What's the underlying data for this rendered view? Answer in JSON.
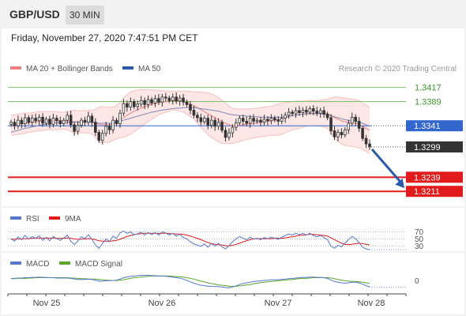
{
  "header": {
    "symbol": "GBP/USD",
    "timeframe": "30 MIN"
  },
  "datetime": "Friday, November 27, 2020 7:47:51 PM CET",
  "credit": "Research © 2020 Trading Central",
  "colors": {
    "bollinger": "#f08080",
    "ma50": "#2a5aa8",
    "candle": "#333333",
    "green_level": "#7cc26a",
    "pivot": "#3366cc",
    "red_level": "#e11b1b",
    "current": "#333333",
    "rsi": "#5577cc",
    "rsi_ma": "#e11b1b",
    "macd": "#5577cc",
    "macd_signal": "#5aa82a",
    "arrow": "#2a5aa8"
  },
  "chart_data": [
    {
      "type": "candlestick",
      "legend": [
        {
          "label": "MA 20 + Bollinger Bands",
          "color": "#f08080"
        },
        {
          "label": "MA 50",
          "color": "#2a5aa8"
        }
      ],
      "ylim": [
        1.318,
        1.344
      ],
      "x_ticks": [
        "Nov 25",
        "Nov 26",
        "Nov 27",
        "Nov 28"
      ],
      "levels": [
        {
          "value": 1.3417,
          "label": "1.3417",
          "style": "green"
        },
        {
          "value": 1.3389,
          "label": "1.3389",
          "style": "green"
        },
        {
          "value": 1.3341,
          "label": "1.3341",
          "style": "pivot"
        },
        {
          "value": 1.3299,
          "label": "1.3299",
          "style": "current"
        },
        {
          "value": 1.3239,
          "label": "1.3239",
          "style": "red"
        },
        {
          "value": 1.3211,
          "label": "1.3211",
          "style": "red"
        }
      ],
      "close": [
        1.3348,
        1.3341,
        1.3352,
        1.3345,
        1.3357,
        1.3348,
        1.3356,
        1.3351,
        1.3358,
        1.3346,
        1.3354,
        1.3344,
        1.3356,
        1.3351,
        1.3345,
        1.3352,
        1.3362,
        1.3343,
        1.333,
        1.3342,
        1.3352,
        1.3348,
        1.336,
        1.3348,
        1.3328,
        1.3312,
        1.3326,
        1.334,
        1.3333,
        1.3352,
        1.3345,
        1.3366,
        1.3385,
        1.3378,
        1.3389,
        1.3379,
        1.3384,
        1.3391,
        1.3383,
        1.3393,
        1.3386,
        1.3395,
        1.3388,
        1.3398,
        1.3396,
        1.3391,
        1.3398,
        1.339,
        1.3396,
        1.3388,
        1.3383,
        1.3372,
        1.3362,
        1.3357,
        1.3349,
        1.3356,
        1.3342,
        1.3352,
        1.334,
        1.3348,
        1.3332,
        1.3318,
        1.3327,
        1.3338,
        1.3347,
        1.3356,
        1.335,
        1.3346,
        1.3356,
        1.335,
        1.3352,
        1.3348,
        1.3354,
        1.3351,
        1.3356,
        1.3353,
        1.335,
        1.3356,
        1.3362,
        1.3368,
        1.3365,
        1.3371,
        1.3367,
        1.3372,
        1.3368,
        1.3375,
        1.337,
        1.3366,
        1.3371,
        1.3364,
        1.3357,
        1.3331,
        1.3319,
        1.3328,
        1.3323,
        1.3333,
        1.3346,
        1.3358,
        1.335,
        1.3336,
        1.3316,
        1.3305,
        1.3299
      ],
      "ma20": [
        1.3342,
        1.3343,
        1.3344,
        1.3345,
        1.3346,
        1.3347,
        1.3348,
        1.3349,
        1.335,
        1.335,
        1.3351,
        1.3351,
        1.3351,
        1.3351,
        1.3351,
        1.3351,
        1.3351,
        1.335,
        1.3349,
        1.3349,
        1.3349,
        1.3349,
        1.3349,
        1.3348,
        1.3346,
        1.3344,
        1.3343,
        1.3343,
        1.3343,
        1.3345,
        1.3348,
        1.3352,
        1.3357,
        1.3362,
        1.3366,
        1.337,
        1.3373,
        1.3376,
        1.3379,
        1.3381,
        1.3383,
        1.3385,
        1.3387,
        1.3388,
        1.3389,
        1.339,
        1.3391,
        1.3391,
        1.339,
        1.3389,
        1.3387,
        1.3384,
        1.3381,
        1.3377,
        1.3373,
        1.3369,
        1.3365,
        1.3361,
        1.3357,
        1.3353,
        1.3349,
        1.3346,
        1.3343,
        1.3341,
        1.3341,
        1.3342,
        1.3343,
        1.3344,
        1.3345,
        1.3346,
        1.3347,
        1.3348,
        1.3349,
        1.335,
        1.3351,
        1.3352,
        1.3353,
        1.3355,
        1.3357,
        1.3359,
        1.3361,
        1.3362,
        1.3363,
        1.3364,
        1.3365,
        1.3366,
        1.3366,
        1.3366,
        1.3366,
        1.3366,
        1.3365,
        1.3361,
        1.3357,
        1.3354,
        1.3351,
        1.3349,
        1.3348,
        1.3347,
        1.3346,
        1.3344,
        1.334,
        1.3336,
        1.3332
      ],
      "bb_upper": [
        1.3362,
        1.3363,
        1.3364,
        1.3365,
        1.3366,
        1.3366,
        1.3367,
        1.3368,
        1.3369,
        1.3369,
        1.3369,
        1.3369,
        1.3369,
        1.3369,
        1.3368,
        1.3368,
        1.3369,
        1.337,
        1.3372,
        1.3371,
        1.3371,
        1.3371,
        1.3372,
        1.3371,
        1.3374,
        1.3378,
        1.3379,
        1.3378,
        1.3378,
        1.3378,
        1.3381,
        1.3387,
        1.3396,
        1.3403,
        1.3408,
        1.3411,
        1.3412,
        1.3413,
        1.3413,
        1.3413,
        1.3412,
        1.3412,
        1.3411,
        1.3411,
        1.341,
        1.341,
        1.341,
        1.341,
        1.341,
        1.341,
        1.341,
        1.3409,
        1.3408,
        1.3408,
        1.3408,
        1.3407,
        1.3407,
        1.3404,
        1.3401,
        1.3397,
        1.3392,
        1.3386,
        1.338,
        1.3376,
        1.3374,
        1.3374,
        1.3374,
        1.3374,
        1.3375,
        1.3375,
        1.3376,
        1.3377,
        1.3378,
        1.3379,
        1.338,
        1.3382,
        1.3384,
        1.3386,
        1.3387,
        1.3388,
        1.3389,
        1.339,
        1.339,
        1.339,
        1.339,
        1.3391,
        1.3391,
        1.3391,
        1.3392,
        1.3393,
        1.3394,
        1.3396,
        1.3398,
        1.3398,
        1.3397,
        1.3396,
        1.3395,
        1.3394,
        1.3393,
        1.3391,
        1.3386,
        1.3382,
        1.3378
      ],
      "bb_lower": [
        1.3322,
        1.3323,
        1.3324,
        1.3325,
        1.3326,
        1.3328,
        1.3329,
        1.333,
        1.3331,
        1.3331,
        1.3333,
        1.3333,
        1.3333,
        1.3333,
        1.3334,
        1.3334,
        1.3333,
        1.333,
        1.3326,
        1.3327,
        1.3327,
        1.3327,
        1.3326,
        1.3325,
        1.3318,
        1.331,
        1.3307,
        1.3308,
        1.3308,
        1.3312,
        1.3315,
        1.3317,
        1.3318,
        1.3321,
        1.3324,
        1.3329,
        1.3334,
        1.3339,
        1.3345,
        1.3349,
        1.3354,
        1.3358,
        1.3363,
        1.3365,
        1.3368,
        1.337,
        1.3372,
        1.3372,
        1.337,
        1.3368,
        1.3364,
        1.3359,
        1.3354,
        1.3346,
        1.3338,
        1.3331,
        1.3323,
        1.3318,
        1.3313,
        1.3309,
        1.3306,
        1.3306,
        1.3306,
        1.3306,
        1.3308,
        1.331,
        1.3312,
        1.3314,
        1.3315,
        1.3317,
        1.3318,
        1.3319,
        1.332,
        1.3321,
        1.3322,
        1.3322,
        1.3322,
        1.3324,
        1.3327,
        1.333,
        1.3333,
        1.3334,
        1.3336,
        1.3338,
        1.334,
        1.3341,
        1.3341,
        1.3341,
        1.334,
        1.3339,
        1.3336,
        1.3326,
        1.3316,
        1.331,
        1.3305,
        1.3302,
        1.3301,
        1.33,
        1.3299,
        1.3297,
        1.3294,
        1.329,
        1.3286
      ],
      "ma50": [
        1.3328,
        1.333,
        1.3332,
        1.3334,
        1.3336,
        1.3337,
        1.3339,
        1.334,
        1.3342,
        1.3343,
        1.3344,
        1.3345,
        1.3346,
        1.3347,
        1.3347,
        1.3348,
        1.3348,
        1.3348,
        1.3348,
        1.3348,
        1.3348,
        1.3348,
        1.3348,
        1.3348,
        1.3347,
        1.3346,
        1.3346,
        1.3346,
        1.3346,
        1.3347,
        1.3348,
        1.335,
        1.3352,
        1.3354,
        1.3356,
        1.3358,
        1.336,
        1.3362,
        1.3364,
        1.3366,
        1.3368,
        1.3369,
        1.3371,
        1.3372,
        1.3373,
        1.3374,
        1.3375,
        1.3376,
        1.3376,
        1.3377,
        1.3377,
        1.3377,
        1.3377,
        1.3376,
        1.3375,
        1.3374,
        1.3373,
        1.3372,
        1.3371,
        1.337,
        1.3368,
        1.3366,
        1.3364,
        1.3363,
        1.3362,
        1.3361,
        1.3361,
        1.336,
        1.336,
        1.3359,
        1.3359,
        1.3358,
        1.3358,
        1.3358,
        1.3358,
        1.3358,
        1.3358,
        1.3358,
        1.3359,
        1.336,
        1.3361,
        1.3362,
        1.3363,
        1.3364,
        1.3365,
        1.3365,
        1.3365,
        1.3365,
        1.3365,
        1.3364,
        1.3363,
        1.3361,
        1.3359,
        1.3357,
        1.3355,
        1.3353,
        1.3352,
        1.3351,
        1.335,
        1.3348,
        1.3346,
        1.3343,
        1.334
      ],
      "forecast": {
        "from": 1.3299,
        "to": 1.3211
      }
    },
    {
      "type": "line",
      "legend": [
        {
          "label": "RSI",
          "color": "#5577cc"
        },
        {
          "label": "9MA",
          "color": "#e11b1b"
        }
      ],
      "ylim": [
        20,
        80
      ],
      "y_ticks": [
        "70",
        "50",
        "30"
      ],
      "series": [
        {
          "name": "RSI",
          "values": [
            50,
            44,
            56,
            48,
            60,
            50,
            57,
            52,
            59,
            46,
            55,
            45,
            57,
            51,
            46,
            53,
            61,
            44,
            34,
            45,
            56,
            51,
            62,
            49,
            33,
            24,
            37,
            50,
            43,
            58,
            52,
            67,
            72,
            66,
            70,
            62,
            65,
            69,
            61,
            68,
            62,
            68,
            61,
            70,
            67,
            61,
            66,
            58,
            63,
            55,
            50,
            42,
            36,
            33,
            29,
            36,
            27,
            37,
            30,
            38,
            28,
            22,
            31,
            42,
            50,
            57,
            52,
            48,
            55,
            50,
            52,
            48,
            54,
            51,
            55,
            52,
            49,
            55,
            60,
            64,
            61,
            66,
            62,
            66,
            61,
            66,
            60,
            56,
            60,
            54,
            48,
            30,
            24,
            32,
            28,
            38,
            48,
            57,
            51,
            40,
            27,
            22,
            20
          ]
        },
        {
          "name": "9MA",
          "values": [
            50,
            49,
            50,
            50,
            51,
            51,
            52,
            52,
            53,
            52,
            53,
            52,
            53,
            52,
            52,
            52,
            53,
            52,
            50,
            49,
            49,
            50,
            51,
            50,
            48,
            45,
            44,
            44,
            43,
            45,
            46,
            49,
            53,
            57,
            60,
            62,
            64,
            65,
            66,
            66,
            66,
            66,
            65,
            66,
            66,
            65,
            65,
            64,
            64,
            63,
            61,
            58,
            55,
            52,
            48,
            44,
            40,
            37,
            35,
            34,
            33,
            31,
            31,
            32,
            35,
            38,
            42,
            45,
            48,
            50,
            51,
            51,
            51,
            51,
            51,
            52,
            52,
            52,
            53,
            55,
            56,
            58,
            60,
            61,
            62,
            63,
            63,
            62,
            61,
            60,
            58,
            53,
            48,
            43,
            38,
            35,
            34,
            35,
            37,
            38,
            37,
            35,
            33
          ]
        }
      ]
    },
    {
      "type": "line",
      "legend": [
        {
          "label": "MACD",
          "color": "#5577cc"
        },
        {
          "label": "MACD Signal",
          "color": "#5aa82a"
        }
      ],
      "ylim": [
        -0.003,
        0.003
      ],
      "y_ticks": [
        "0"
      ],
      "series": [
        {
          "name": "MACD",
          "values": [
            0.0006,
            0.0006,
            0.0007,
            0.0007,
            0.0008,
            0.0008,
            0.0009,
            0.0009,
            0.001,
            0.0009,
            0.0009,
            0.0008,
            0.0008,
            0.0007,
            0.0007,
            0.0007,
            0.0007,
            0.0006,
            0.0004,
            0.0003,
            0.0003,
            0.0003,
            0.0004,
            0.0003,
            0.0001,
            -0.0002,
            -0.0002,
            -0.0001,
            -0.0001,
            0.0,
            0.0001,
            0.0004,
            0.0008,
            0.001,
            0.0012,
            0.0013,
            0.0014,
            0.0015,
            0.0015,
            0.0015,
            0.0014,
            0.0014,
            0.0013,
            0.0013,
            0.0012,
            0.0011,
            0.001,
            0.0008,
            0.0007,
            0.0004,
            0.0,
            -0.0004,
            -0.0008,
            -0.0011,
            -0.0014,
            -0.0015,
            -0.0017,
            -0.0017,
            -0.0018,
            -0.0018,
            -0.0019,
            -0.0021,
            -0.0021,
            -0.0019,
            -0.0016,
            -0.0012,
            -0.0009,
            -0.0007,
            -0.0005,
            -0.0003,
            -0.0002,
            -0.0001,
            0.0,
            0.0001,
            0.0002,
            0.0002,
            0.0002,
            0.0003,
            0.0004,
            0.0005,
            0.0006,
            0.0007,
            0.0008,
            0.0009,
            0.0009,
            0.001,
            0.001,
            0.0009,
            0.0009,
            0.0008,
            0.0006,
            0.0001,
            -0.0003,
            -0.0005,
            -0.0007,
            -0.0008,
            -0.0007,
            -0.0005,
            -0.0005,
            -0.0007,
            -0.0011,
            -0.0015,
            -0.0019
          ]
        },
        {
          "name": "MACD Signal",
          "values": [
            0.0005,
            0.0005,
            0.0006,
            0.0006,
            0.0006,
            0.0007,
            0.0007,
            0.0008,
            0.0008,
            0.0008,
            0.0008,
            0.0008,
            0.0008,
            0.0008,
            0.0008,
            0.0008,
            0.0008,
            0.0007,
            0.0007,
            0.0006,
            0.0005,
            0.0005,
            0.0004,
            0.0004,
            0.0004,
            0.0003,
            0.0002,
            0.0001,
            0.0,
            0.0,
            0.0,
            0.0001,
            0.0002,
            0.0004,
            0.0006,
            0.0008,
            0.0009,
            0.001,
            0.0011,
            0.0012,
            0.0013,
            0.0013,
            0.0013,
            0.0013,
            0.0013,
            0.0013,
            0.0012,
            0.0011,
            0.0011,
            0.001,
            0.0008,
            0.0006,
            0.0004,
            0.0001,
            -0.0002,
            -0.0004,
            -0.0007,
            -0.0009,
            -0.0011,
            -0.0013,
            -0.0014,
            -0.0015,
            -0.0017,
            -0.0017,
            -0.0017,
            -0.0016,
            -0.0015,
            -0.0013,
            -0.0012,
            -0.001,
            -0.0008,
            -0.0006,
            -0.0005,
            -0.0004,
            -0.0003,
            -0.0002,
            -0.0001,
            0.0,
            0.0001,
            0.0002,
            0.0003,
            0.0004,
            0.0005,
            0.0006,
            0.0006,
            0.0007,
            0.0008,
            0.0008,
            0.0008,
            0.0008,
            0.0008,
            0.0007,
            0.0005,
            0.0003,
            0.0001,
            -0.0001,
            -0.0002,
            -0.0003,
            -0.0003,
            -0.0004,
            -0.0005,
            -0.0007,
            -0.0009
          ]
        }
      ]
    }
  ]
}
